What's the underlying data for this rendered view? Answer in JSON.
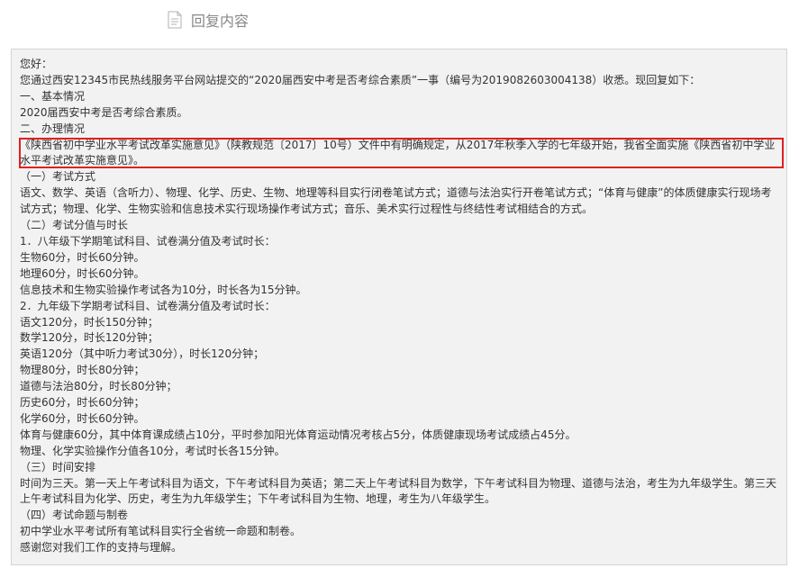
{
  "header": {
    "title": "回复内容"
  },
  "reply": {
    "lines": [
      "您好：",
      "您通过西安12345市民热线服务平台网站提交的“2020届西安中考是否考综合素质”一事（编号为2019082603004138）收悉。现回复如下：",
      "一、基本情况",
      "2020届西安中考是否考综合素质。",
      "二、办理情况",
      "《陕西省初中学业水平考试改革实施意见》（陕教规范〔2017〕10号）文件中有明确规定，从2017年秋季入学的七年级开始，我省全面实施《陕西省初中学业",
      "水平考试改革实施意见》。",
      "（一）考试方式",
      "语文、数学、英语（含听力）、物理、化学、历史、生物、地理等科目实行闭卷笔试方式；道德与法治实行开卷笔试方式；“体育与健康”的体质健康实行现场考",
      "试方式；物理、化学、生物实验和信息技术实行现场操作考试方式；音乐、美术实行过程性与终结性考试相结合的方式。",
      "（二）考试分值与时长",
      "1．八年级下学期笔试科目、试卷满分值及考试时长：",
      "生物60分，时长60分钟。",
      "地理60分，时长60分钟。",
      "信息技术和生物实验操作考试各为10分，时长各为15分钟。",
      "2．九年级下学期考试科目、试卷满分值及考试时长：",
      "语文120分，时长150分钟；",
      "数学120分，时长120分钟；",
      "英语120分（其中听力考试30分），时长120分钟；",
      "物理80分，时长80分钟；",
      "道德与法治80分，时长80分钟；",
      "历史60分，时长60分钟；",
      "化学60分，时长60分钟。",
      "体育与健康60分，其中体育课成绩占10分，平时参加阳光体育运动情况考核占5分，体质健康现场考试成绩占45分。",
      "物理、化学实验操作分值各10分，考试时长各15分钟。",
      "（三）时间安排",
      "时间为三天。第一天上午考试科目为语文，下午考试科目为英语；第二天上午考试科目为数学，下午考试科目为物理、道德与法治，考生为九年级学生。第三天",
      "上午考试科目为化学、历史，考生为九年级学生；下午考试科目为生物、地理，考生为八年级学生。",
      "（四）考试命题与制卷",
      "初中学业水平考试所有笔试科目实行全省统一命题和制卷。",
      "感谢您对我们工作的支持与理解。"
    ]
  },
  "colors": {
    "highlight_border": "#e02020",
    "box_background": "#f2f2f2",
    "box_border": "#d4d4d4",
    "header_text": "#888888"
  },
  "icons": {
    "header_icon": "document-icon"
  }
}
